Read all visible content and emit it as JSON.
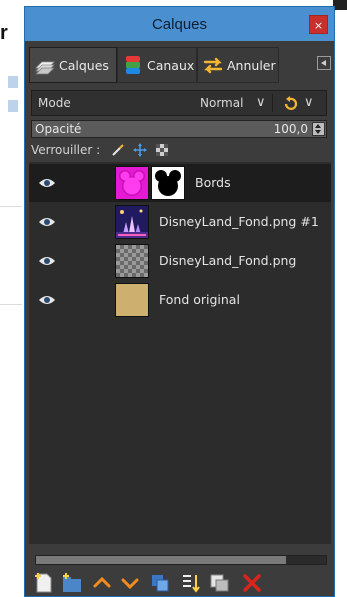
{
  "window": {
    "title": "Calques",
    "close_symbol": "×"
  },
  "background": {
    "fragment": "r"
  },
  "tabs": [
    {
      "label": "Calques",
      "icon": "layers-icon",
      "active": true
    },
    {
      "label": "Canaux",
      "icon": "channels-icon",
      "active": false
    },
    {
      "label": "Annuler",
      "icon": "undo-history-icon",
      "active": false
    }
  ],
  "mode": {
    "label": "Mode",
    "value": "Normal"
  },
  "opacity": {
    "label": "Opacité",
    "value": "100,0"
  },
  "lock": {
    "label": "Verrouiller :"
  },
  "layers": [
    {
      "name": "Bords",
      "selected": true,
      "thumb": "magenta-mickey",
      "has_mask": true
    },
    {
      "name": "DisneyLand_Fond.png #1",
      "selected": false,
      "thumb": "castle-night",
      "has_mask": false
    },
    {
      "name": "DisneyLand_Fond.png",
      "selected": false,
      "thumb": "transparent-checker",
      "has_mask": false
    },
    {
      "name": "Fond original",
      "selected": false,
      "thumb": "tan-fill",
      "has_mask": false
    }
  ],
  "scroll": {
    "position_fraction": 0.86
  },
  "colors": {
    "accent": "#4a8fd0",
    "panel": "#3c3c3c",
    "list": "#2c2c2c",
    "selected_row": "#1d1d1d",
    "close": "#c9302c"
  },
  "toolbar_icons": [
    "new-layer-icon",
    "new-layer-group-icon",
    "raise-layer-icon",
    "lower-layer-icon",
    "duplicate-layer-icon",
    "anchor-layer-icon",
    "merge-down-icon",
    "delete-layer-icon"
  ]
}
